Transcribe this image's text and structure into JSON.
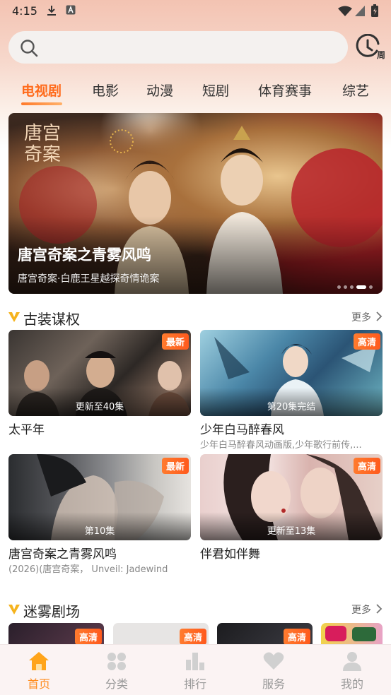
{
  "status_bar": {
    "time": "4:15",
    "icons": [
      "download-icon",
      "a-app-icon",
      "wifi-icon",
      "signal-icon",
      "battery-icon"
    ]
  },
  "search": {
    "placeholder": "",
    "history_badge": "周"
  },
  "tabs": [
    {
      "label": "电视剧",
      "active": true
    },
    {
      "label": "电影",
      "active": false
    },
    {
      "label": "动漫",
      "active": false
    },
    {
      "label": "短剧",
      "active": false
    },
    {
      "label": "体育赛事",
      "active": false
    },
    {
      "label": "综艺",
      "active": false
    }
  ],
  "banner": {
    "title": "唐宫奇案之青雾风鸣",
    "subtitle": "唐宫奇案·白鹿王星越探奇情诡案",
    "poster_calligraphy": "唐宫奇案",
    "page_count": 5,
    "active_page": 4
  },
  "section_1": {
    "title": "古装谋权",
    "more": "更多",
    "cards": [
      {
        "title": "太平年",
        "badge": "最新",
        "episode": "更新至40集",
        "desc": ""
      },
      {
        "title": "少年白马醉春风",
        "badge": "高清",
        "episode": "第20集完结",
        "desc": "少年白马醉春风动画版,少年歌行前传,..."
      },
      {
        "title": "唐宫奇案之青雾风鸣",
        "badge": "最新",
        "episode": "第10集",
        "desc": "(2026)(唐宫奇案， Unveil: Jadewind"
      },
      {
        "title": "伴君如伴舞",
        "badge": "高清",
        "episode": "更新至13集",
        "desc": ""
      }
    ]
  },
  "section_2": {
    "title": "迷雾剧场",
    "more": "更多",
    "badges": [
      "高清",
      "高清",
      "高清",
      ""
    ]
  },
  "bottom_nav": [
    {
      "label": "首页",
      "icon": "home-icon",
      "active": true
    },
    {
      "label": "分类",
      "icon": "category-icon",
      "active": false
    },
    {
      "label": "排行",
      "icon": "ranking-icon",
      "active": false
    },
    {
      "label": "服务",
      "icon": "heart-icon",
      "active": false
    },
    {
      "label": "我的",
      "icon": "user-icon",
      "active": false
    }
  ],
  "colors": {
    "accent": "#ff6a1a",
    "badge": "#ff5a1d",
    "nav_active": "#ff8a1a",
    "section_mark": "#f5b31d"
  }
}
